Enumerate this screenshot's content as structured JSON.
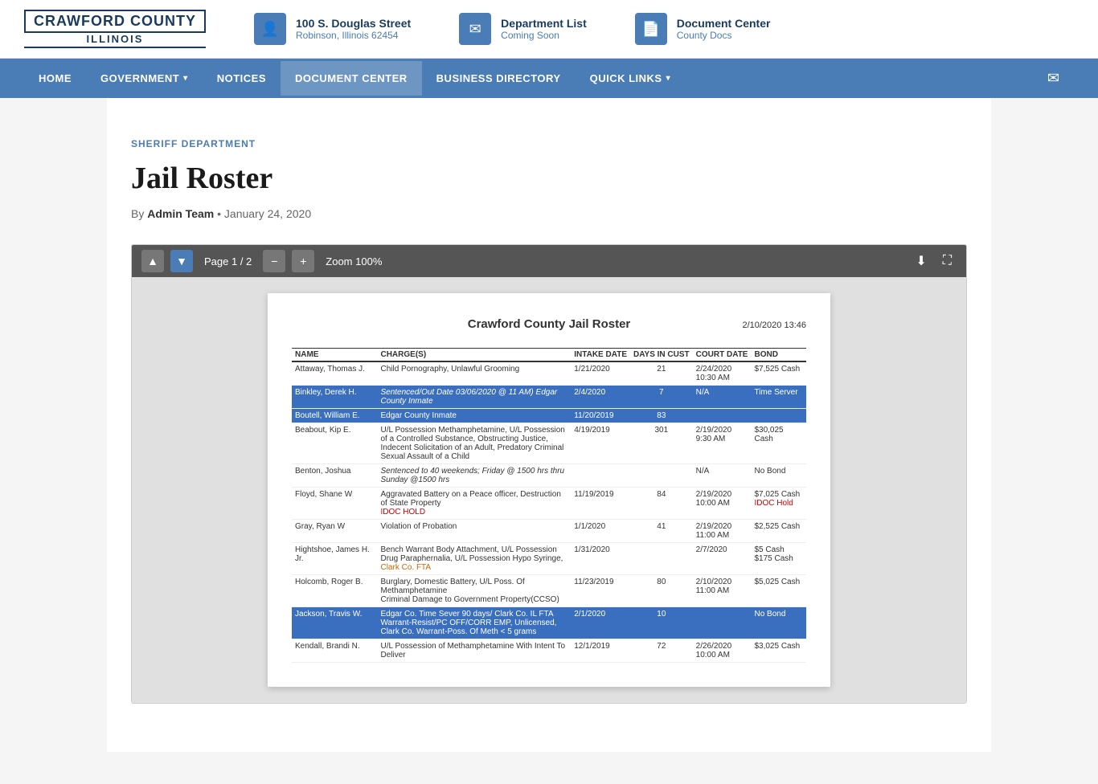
{
  "header": {
    "logo_line1": "CRAWFORD COUNTY",
    "logo_line2": "ILLINOIS",
    "address_line1": "100 S. Douglas Street",
    "address_line2": "Robinson, Illinois 62454",
    "dept_list_label": "Department List",
    "dept_list_sub": "Coming Soon",
    "doc_center_label": "Document Center",
    "doc_center_sub": "County Docs"
  },
  "nav": {
    "items": [
      {
        "label": "HOME",
        "has_chevron": false
      },
      {
        "label": "GOVERNMENT",
        "has_chevron": true
      },
      {
        "label": "NOTICES",
        "has_chevron": false
      },
      {
        "label": "DOCUMENT CENTER",
        "has_chevron": false
      },
      {
        "label": "BUSINESS DIRECTORY",
        "has_chevron": false
      },
      {
        "label": "QUICK LINKS",
        "has_chevron": true
      }
    ]
  },
  "content": {
    "department": "SHERIFF DEPARTMENT",
    "title": "Jail Roster",
    "author": "Admin Team",
    "date": "January 24, 2020"
  },
  "pdf": {
    "toolbar": {
      "page_info": "Page 1 / 2",
      "zoom_label": "Zoom 100%"
    },
    "doc_title": "Crawford County Jail Roster",
    "doc_date": "2/10/2020 13:46",
    "table_headers": [
      "NAME",
      "CHARGE(S)",
      "INTAKE DATE",
      "DAYS IN CUST",
      "COURT DATE",
      "BOND"
    ],
    "rows": [
      {
        "name": "Attaway, Thomas J.",
        "charges": "Child Pornography, Unlawful Grooming",
        "intake": "1/21/2020",
        "days": "21",
        "court": "2/24/2020\n10:30 AM",
        "bond": "$7,525 Cash",
        "highlight": false,
        "charges_italic": false
      },
      {
        "name": "Binkley, Derek H.",
        "charges": "Sentenced/Out Date 03/06/2020 @ 11 AM) Edgar County Inmate",
        "intake": "2/4/2020",
        "days": "7",
        "court": "N/A",
        "bond": "Time Server",
        "highlight": true,
        "charges_italic": true
      },
      {
        "name": "Boutell, William E.",
        "charges": "Edgar County Inmate",
        "intake": "11/20/2019",
        "days": "83",
        "court": "",
        "bond": "",
        "highlight": true,
        "charges_italic": false
      },
      {
        "name": "Beabout, Kip E.",
        "charges": "U/L Possession Methamphetamine, U/L Possession of a Controlled Substance, Obstructing Justice, Indecent Solicitation of an Adult, Predatory Criminal Sexual Assault of a Child",
        "intake": "4/19/2019",
        "days": "301",
        "court": "2/19/2020\n9:30 AM",
        "bond": "$30,025 Cash",
        "highlight": false,
        "charges_italic": false
      },
      {
        "name": "Benton, Joshua",
        "charges": "Sentenced to 40 weekends; Friday @ 1500 hrs thru Sunday @1500 hrs",
        "intake": "",
        "days": "",
        "court": "N/A",
        "bond": "No Bond",
        "highlight": false,
        "charges_italic": true
      },
      {
        "name": "Floyd, Shane W",
        "charges": "Aggravated Battery on a Peace officer, Destruction of State Property\nIDOC HOLD",
        "intake": "11/19/2019",
        "days": "84",
        "court": "2/19/2020\n10:00 AM",
        "bond": "$7,025 Cash\nIDOC Hold",
        "highlight": false,
        "charges_italic": false,
        "charges_has_red": true,
        "bond_has_red": true
      },
      {
        "name": "Gray, Ryan W",
        "charges": "Violation of Probation",
        "intake": "1/1/2020",
        "days": "41",
        "court": "2/19/2020\n11:00 AM",
        "bond": "$2,525 Cash",
        "highlight": false,
        "charges_italic": false
      },
      {
        "name": "Hightshoe, James H. Jr.",
        "charges": "Bench Warrant Body Attachment, U/L Possession Drug Paraphernalia, U/L Possession Hypo Syringe, Clark Co. FTA",
        "intake": "1/31/2020",
        "days": "",
        "court": "2/7/2020",
        "bond": "$5 Cash\n$175 Cash",
        "highlight": false,
        "charges_italic": false,
        "charges_has_orange": true
      },
      {
        "name": "Holcomb, Roger B.",
        "charges": "Burglary, Domestic Battery, U/L Poss. Of Methamphetamine\nCriminal Damage to Government Property(CCSO)",
        "intake": "11/23/2019",
        "days": "80",
        "court": "2/10/2020\n11:00 AM",
        "bond": "$5,025 Cash",
        "highlight": false,
        "charges_italic": false
      },
      {
        "name": "Jackson, Travis W.",
        "charges": "Edgar Co. Time Sever 90 days/ Clark Co. IL FTA Warrant-Resist/PC OFF/CORR EMP, Unlicensed, Clark Co. Warrant-Poss. Of Meth < 5 grams",
        "intake": "2/1/2020",
        "days": "10",
        "court": "",
        "bond": "No Bond",
        "highlight": true,
        "charges_italic": false
      },
      {
        "name": "Kendall, Brandi N.",
        "charges": "U/L Possession of Methamphetamine With Intent To Deliver",
        "intake": "12/1/2019",
        "days": "72",
        "court": "2/26/2020\n10:00 AM",
        "bond": "$3,025 Cash",
        "highlight": false,
        "charges_italic": false
      }
    ]
  }
}
